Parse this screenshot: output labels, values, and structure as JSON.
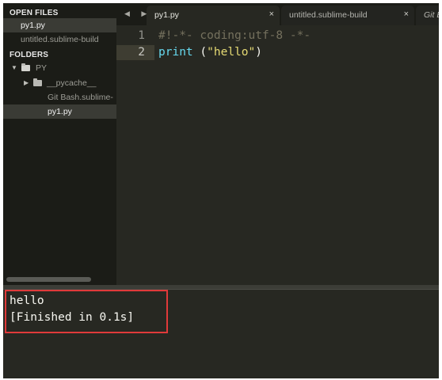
{
  "sidebar": {
    "open_files_heading": "OPEN FILES",
    "open_files": [
      {
        "label": "py1.py",
        "active": true
      },
      {
        "label": "untitled.sublime-build",
        "active": false
      }
    ],
    "folders_heading": "FOLDERS",
    "tree": {
      "root": "PY",
      "subfolder": "__pycache__",
      "files": [
        "Git Bash.sublime-",
        "py1.py"
      ]
    }
  },
  "tabs": {
    "nav": "◀ ▶",
    "items": [
      {
        "label": "py1.py",
        "active": true,
        "close": "×"
      },
      {
        "label": "untitled.sublime-build",
        "active": false,
        "close": "×"
      },
      {
        "label": "Git Bo",
        "active": false
      }
    ]
  },
  "editor": {
    "lines": [
      {
        "number": "1",
        "comment": "#!-*- coding:utf-8 -*-"
      },
      {
        "number": "2",
        "func": "print",
        "space": " (",
        "string": "\"hello\"",
        "close": ")"
      }
    ],
    "current_line": 2
  },
  "output": {
    "lines": [
      "hello",
      "[Finished in 0.1s]"
    ]
  },
  "colors": {
    "background": "#272822",
    "sidebar": "#1b1c17",
    "highlight_box": "#e03a3a",
    "comment": "#75715e",
    "keyword": "#66d9ef",
    "string": "#e6db74"
  }
}
